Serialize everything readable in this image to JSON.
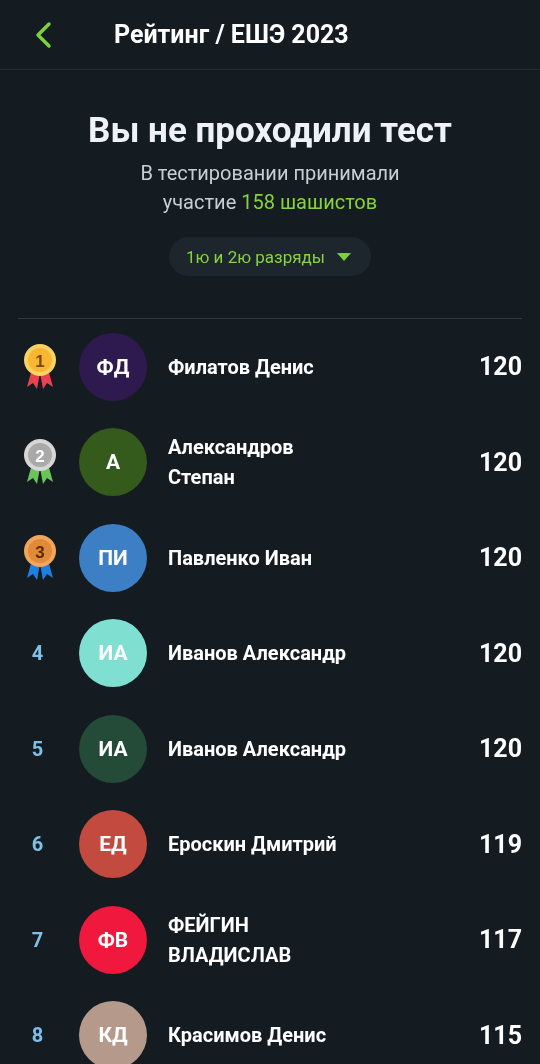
{
  "header": {
    "title": "Рейтинг / ЕШЭ 2023"
  },
  "summary": {
    "heading": "Вы не проходили тест",
    "text": "В тестировании принимали участие",
    "highlight": "158 шашистов"
  },
  "filter": {
    "label": "1ю и 2ю разряды"
  },
  "rows": [
    {
      "rank": "1",
      "kind": "gold",
      "initials": "ФД",
      "color": "#2e1a4f",
      "name": "Филатов Денис",
      "score": "120"
    },
    {
      "rank": "2",
      "kind": "silver",
      "initials": "А",
      "color": "#345a1c",
      "name": "Александров Степан",
      "score": "120"
    },
    {
      "rank": "3",
      "kind": "bronze",
      "initials": "ПИ",
      "color": "#3d7fc4",
      "name": "Павленко Иван",
      "score": "120"
    },
    {
      "rank": "4",
      "kind": "plain",
      "initials": "ИА",
      "color": "#7fe0d2",
      "name": "Иванов Александр",
      "score": "120"
    },
    {
      "rank": "5",
      "kind": "plain",
      "initials": "ИА",
      "color": "#244a38",
      "name": "Иванов Александр",
      "score": "120"
    },
    {
      "rank": "6",
      "kind": "plain",
      "initials": "ЕД",
      "color": "#c24a3e",
      "name": "Ероскин Дмитрий",
      "score": "119"
    },
    {
      "rank": "7",
      "kind": "plain",
      "initials": "ФВ",
      "color": "#f0183c",
      "name": "ФЕЙГИН ВЛАДИСЛАВ",
      "score": "117"
    },
    {
      "rank": "8",
      "kind": "plain",
      "initials": "КД",
      "color": "#b59a8c",
      "name": "Красимов Денис",
      "score": "115"
    }
  ]
}
